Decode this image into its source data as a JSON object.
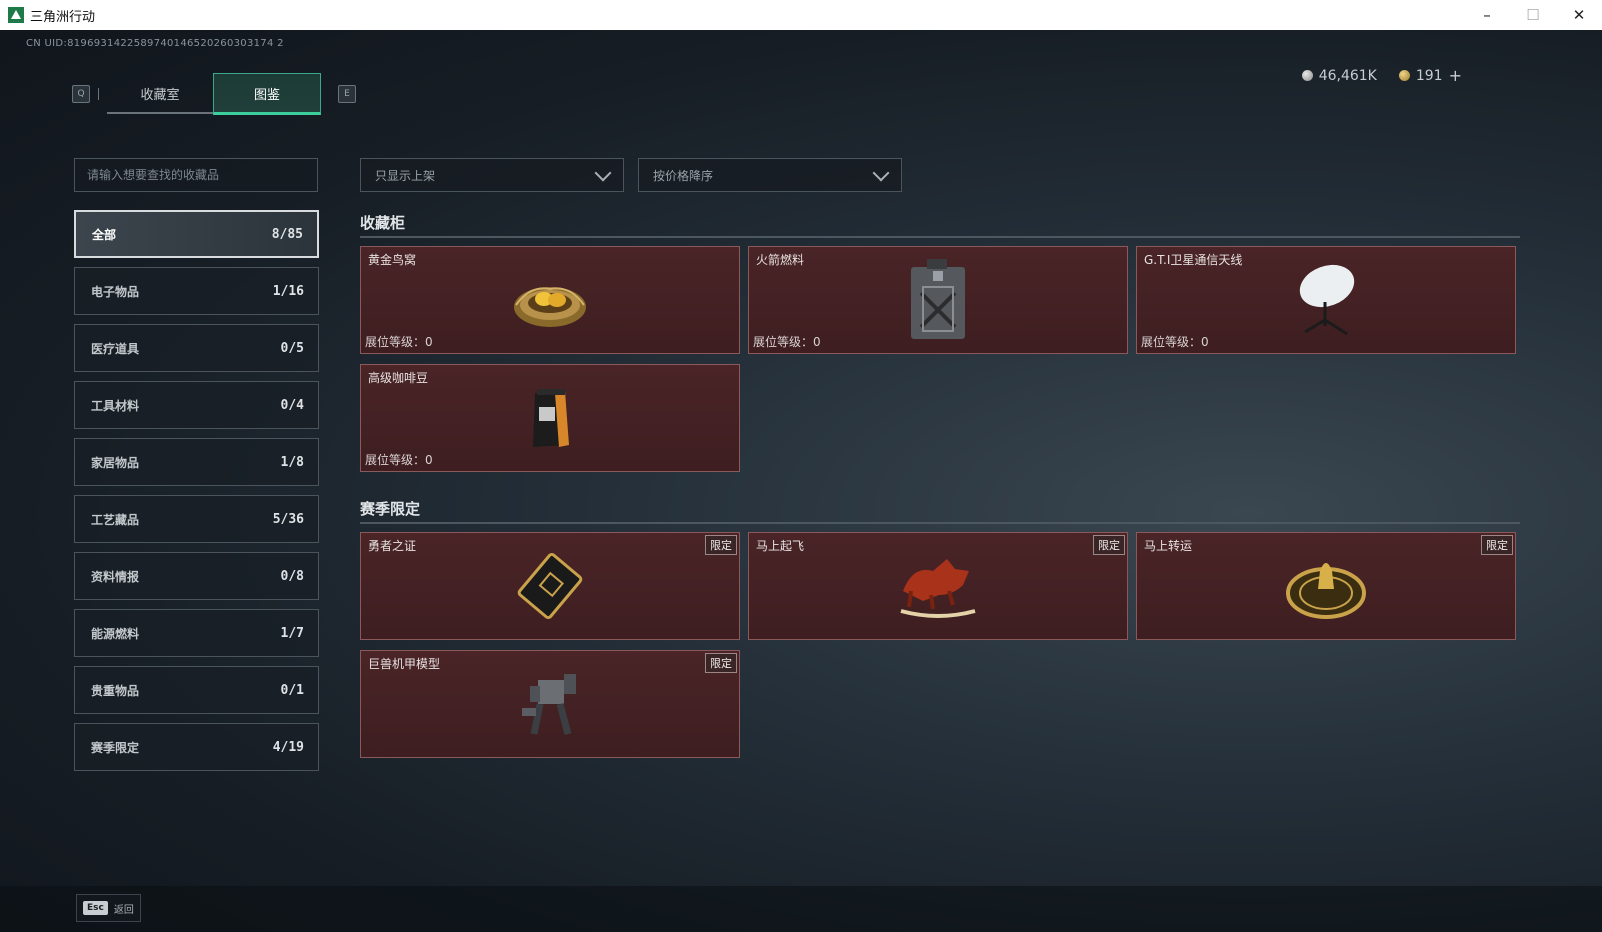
{
  "window": {
    "title": "三角洲行动",
    "minimize": "–",
    "maximize": "☐",
    "close": "✕"
  },
  "uid": "CN UID:8196931422589740146520260303174 2",
  "tabs": {
    "left_key": "Q",
    "right_key": "E",
    "items": [
      {
        "label": "收藏室"
      },
      {
        "label": "图鉴",
        "active": true
      }
    ]
  },
  "currency": {
    "silver": "46,461K",
    "gold": "191",
    "add": "+"
  },
  "search": {
    "placeholder": "请输入想要查找的收藏品"
  },
  "categories": [
    {
      "label": "全部",
      "count": "8/85",
      "active": true
    },
    {
      "label": "电子物品",
      "count": "1/16"
    },
    {
      "label": "医疗道具",
      "count": "0/5"
    },
    {
      "label": "工具材料",
      "count": "0/4"
    },
    {
      "label": "家居物品",
      "count": "1/8"
    },
    {
      "label": "工艺藏品",
      "count": "5/36"
    },
    {
      "label": "资料情报",
      "count": "0/8"
    },
    {
      "label": "能源燃料",
      "count": "1/7"
    },
    {
      "label": "贵重物品",
      "count": "0/1"
    },
    {
      "label": "赛季限定",
      "count": "4/19"
    }
  ],
  "filters": {
    "display": "只显示上架",
    "sort": "按价格降序"
  },
  "sections": {
    "cabinet": {
      "title": "收藏柜",
      "items": [
        {
          "name": "黄金鸟窝",
          "level": "展位等级：0",
          "icon": "golden-nest"
        },
        {
          "name": "火箭燃料",
          "level": "展位等级：0",
          "icon": "fuel-canister"
        },
        {
          "name": "G.T.I卫星通信天线",
          "level": "展位等级：0",
          "icon": "satellite-dish"
        },
        {
          "name": "高级咖啡豆",
          "level": "展位等级：0",
          "icon": "coffee-bag"
        }
      ]
    },
    "season": {
      "title": "赛季限定",
      "badge": "限定",
      "items": [
        {
          "name": "勇者之证",
          "icon": "brave-card"
        },
        {
          "name": "马上起飞",
          "icon": "red-horse"
        },
        {
          "name": "马上转运",
          "icon": "gold-wheel"
        },
        {
          "name": "巨兽机甲模型",
          "icon": "mech-model"
        }
      ]
    }
  },
  "footer": {
    "key": "Esc",
    "label": "返回"
  }
}
